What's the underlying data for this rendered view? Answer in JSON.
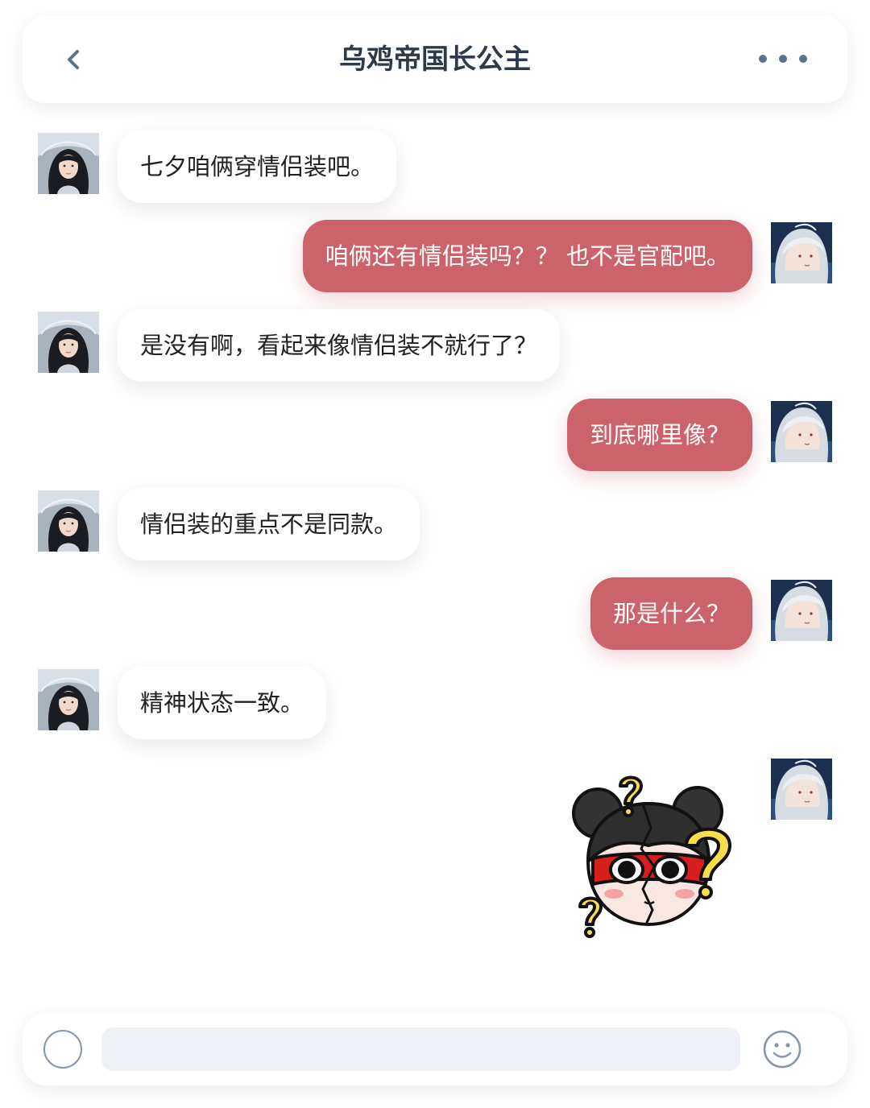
{
  "header": {
    "title": "乌鸡帝国长公主",
    "back_icon": "chevron-left-icon",
    "more_icon": "more-dots-icon"
  },
  "contacts": {
    "left": {
      "avatar_icon": "avatar-woman-icon"
    },
    "right": {
      "avatar_icon": "avatar-silver-hair-icon"
    }
  },
  "messages": [
    {
      "side": "in",
      "text": "七夕咱俩穿情侣装吧。"
    },
    {
      "side": "out",
      "text": "咱俩还有情侣装吗？？ 也不是官配吧。"
    },
    {
      "side": "in",
      "text": "是没有啊，看起来像情侣装不就行了？"
    },
    {
      "side": "out",
      "text": "到底哪里像？"
    },
    {
      "side": "in",
      "text": "情侣装的重点不是同款。"
    },
    {
      "side": "out",
      "text": "那是什么？"
    },
    {
      "side": "in",
      "text": "精神状态一致。"
    },
    {
      "side": "out",
      "sticker": "confused-panda-sticker"
    }
  ],
  "colors": {
    "outgoing_bubble": "#cd636a",
    "incoming_bubble": "#ffffff",
    "title": "#2d3a4b"
  },
  "composer": {
    "placeholder": "",
    "value": "",
    "voice_icon": "voice-circle-icon",
    "emoji_icon": "smiley-icon"
  }
}
